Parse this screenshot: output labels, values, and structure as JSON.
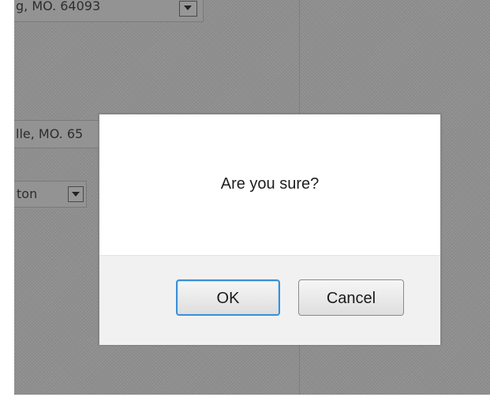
{
  "background": {
    "fields": [
      {
        "text": "g, MO. 64093"
      },
      {
        "text": "lle, MO. 65"
      },
      {
        "text": "ton"
      }
    ]
  },
  "dialog": {
    "message": "Are you sure?",
    "ok_label": "OK",
    "cancel_label": "Cancel"
  },
  "colors": {
    "overlay": "#8f8f8f",
    "focus_ring": "#3a8fd6",
    "footer": "#f1f1f1"
  },
  "icons": [
    "dropdown-arrow-icon"
  ]
}
